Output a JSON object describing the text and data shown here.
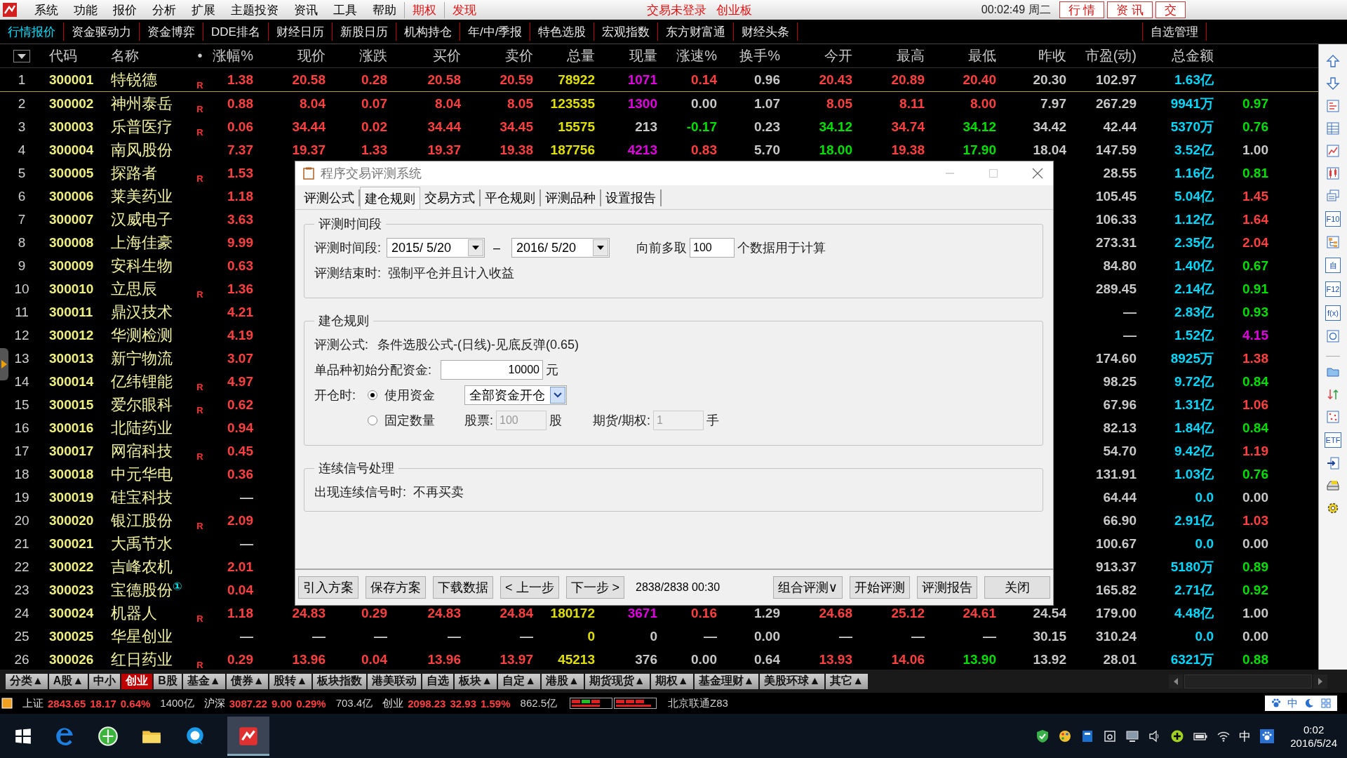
{
  "menu_bar": {
    "items": [
      "系统",
      "功能",
      "报价",
      "分析",
      "扩展",
      "主题投资",
      "资讯",
      "工具",
      "帮助"
    ],
    "highlight_items": [
      "期权",
      "发现"
    ],
    "status": [
      "交易未登录",
      "创业板"
    ],
    "clock": "00:02:49 周二",
    "buttons": [
      "行 情",
      "资 讯",
      "交"
    ]
  },
  "toolbar": {
    "tabs": [
      {
        "label": "行情报价",
        "selected": true
      },
      {
        "label": "资金驱动力",
        "selected": false
      },
      {
        "label": "资金博弈",
        "selected": false
      },
      {
        "label": "DDE排名",
        "selected": false
      },
      {
        "label": "财经日历",
        "selected": false
      },
      {
        "label": "新股日历",
        "selected": false
      },
      {
        "label": "机构持仓",
        "selected": false
      },
      {
        "label": "年/中/季报",
        "selected": false
      },
      {
        "label": "特色选股",
        "selected": false
      },
      {
        "label": "宏观指数",
        "selected": false
      },
      {
        "label": "东方财富通",
        "selected": false
      },
      {
        "label": "财经头条",
        "selected": false
      }
    ],
    "right_tab": "自选管理"
  },
  "table": {
    "key_columns": [
      "代码",
      "名称",
      "•"
    ],
    "columns": [
      "涨幅%",
      "现价",
      "涨跌",
      "买价",
      "卖价",
      "总量",
      "现量",
      "涨速%",
      "换手%",
      "今开",
      "最高",
      "最低",
      "昨收",
      "市盈(动)",
      "总金额"
    ],
    "rows": [
      {
        "no": "1",
        "code": "300001",
        "name": "特锐德",
        "flag": "R",
        "cells": [
          {
            "text": "1.38",
            "color": "#ff4040"
          },
          {
            "text": "20.58",
            "color": "#ff4040"
          },
          {
            "text": "0.28",
            "color": "#ff4040"
          },
          {
            "text": "20.58",
            "color": "#ff4040"
          },
          {
            "text": "20.59",
            "color": "#ff4040"
          },
          {
            "text": "78922",
            "color": "#e0e000"
          },
          {
            "text": "1071",
            "color": "#e000e0"
          },
          {
            "text": "0.14",
            "color": "#ff4040"
          },
          {
            "text": "0.96",
            "color": "#c8c8c8"
          },
          {
            "text": "20.43",
            "color": "#ff4040"
          },
          {
            "text": "20.89",
            "color": "#ff4040"
          },
          {
            "text": "20.40",
            "color": "#ff4040"
          },
          {
            "text": "20.30",
            "color": "#c8c8c8"
          },
          {
            "text": "102.97",
            "color": "#c8c8c8"
          },
          {
            "text": "1.63亿",
            "color": "#00d8ff"
          },
          null
        ]
      },
      {
        "no": "2",
        "code": "300002",
        "name": "神州泰岳",
        "flag": "R",
        "cells": [
          {
            "text": "0.88",
            "color": "#ff4040"
          },
          {
            "text": "8.04",
            "color": "#ff4040"
          },
          {
            "text": "0.07",
            "color": "#ff4040"
          },
          {
            "text": "8.04",
            "color": "#ff4040"
          },
          {
            "text": "8.05",
            "color": "#ff4040"
          },
          {
            "text": "123535",
            "color": "#e0e000"
          },
          {
            "text": "1300",
            "color": "#e000e0"
          },
          {
            "text": "0.00",
            "color": "#c8c8c8"
          },
          {
            "text": "1.07",
            "color": "#c8c8c8"
          },
          {
            "text": "8.05",
            "color": "#ff4040"
          },
          {
            "text": "8.11",
            "color": "#ff4040"
          },
          {
            "text": "8.00",
            "color": "#ff4040"
          },
          {
            "text": "7.97",
            "color": "#c8c8c8"
          },
          {
            "text": "267.29",
            "color": "#c8c8c8"
          },
          {
            "text": "9941万",
            "color": "#00d8ff"
          },
          {
            "text": "0.97",
            "color": "#00e000"
          }
        ]
      },
      {
        "no": "3",
        "code": "300003",
        "name": "乐普医疗",
        "flag": "R",
        "cells": [
          {
            "text": "0.06",
            "color": "#ff4040"
          },
          {
            "text": "34.44",
            "color": "#ff4040"
          },
          {
            "text": "0.02",
            "color": "#ff4040"
          },
          {
            "text": "34.44",
            "color": "#ff4040"
          },
          {
            "text": "34.45",
            "color": "#ff4040"
          },
          {
            "text": "15575",
            "color": "#e0e000"
          },
          {
            "text": "213",
            "color": "#c8c8c8"
          },
          {
            "text": "-0.17",
            "color": "#00e000"
          },
          {
            "text": "0.23",
            "color": "#c8c8c8"
          },
          {
            "text": "34.12",
            "color": "#00e000"
          },
          {
            "text": "34.74",
            "color": "#ff4040"
          },
          {
            "text": "34.12",
            "color": "#00e000"
          },
          {
            "text": "34.42",
            "color": "#c8c8c8"
          },
          {
            "text": "42.44",
            "color": "#c8c8c8"
          },
          {
            "text": "5370万",
            "color": "#00d8ff"
          },
          {
            "text": "0.76",
            "color": "#00e000"
          }
        ]
      },
      {
        "no": "4",
        "code": "300004",
        "name": "南风股份",
        "cells": [
          {
            "text": "7.37",
            "color": "#ff4040"
          },
          {
            "text": "19.37",
            "color": "#ff4040"
          },
          {
            "text": "1.33",
            "color": "#ff4040"
          },
          {
            "text": "19.37",
            "color": "#ff4040"
          },
          {
            "text": "19.38",
            "color": "#ff4040"
          },
          {
            "text": "187756",
            "color": "#e0e000"
          },
          {
            "text": "4213",
            "color": "#e000e0"
          },
          {
            "text": "0.83",
            "color": "#ff4040"
          },
          {
            "text": "5.70",
            "color": "#c8c8c8"
          },
          {
            "text": "18.00",
            "color": "#00e000"
          },
          {
            "text": "19.38",
            "color": "#ff4040"
          },
          {
            "text": "17.90",
            "color": "#00e000"
          },
          {
            "text": "18.04",
            "color": "#c8c8c8"
          },
          {
            "text": "147.59",
            "color": "#c8c8c8"
          },
          {
            "text": "3.52亿",
            "color": "#00d8ff"
          },
          {
            "text": "1.00",
            "color": "#c8c8c8"
          }
        ]
      },
      {
        "no": "5",
        "code": "300005",
        "name": "探路者",
        "flag": "R",
        "cells": [
          {
            "text": "1.53",
            "color": "#ff4040"
          },
          null,
          null,
          null,
          null,
          null,
          null,
          null,
          null,
          null,
          null,
          null,
          null,
          {
            "text": "28.55",
            "color": "#c8c8c8"
          },
          {
            "text": "1.16亿",
            "color": "#00d8ff"
          },
          {
            "text": "0.81",
            "color": "#00e000"
          }
        ]
      },
      {
        "no": "6",
        "code": "300006",
        "name": "莱美药业",
        "cells": [
          {
            "text": "1.18",
            "color": "#ff4040"
          },
          null,
          null,
          null,
          null,
          null,
          null,
          null,
          null,
          null,
          null,
          null,
          null,
          {
            "text": "105.45",
            "color": "#c8c8c8"
          },
          {
            "text": "5.04亿",
            "color": "#00d8ff"
          },
          {
            "text": "1.45",
            "color": "#ff4040"
          }
        ]
      },
      {
        "no": "7",
        "code": "300007",
        "name": "汉威电子",
        "cells": [
          {
            "text": "3.63",
            "color": "#ff4040"
          },
          null,
          null,
          null,
          null,
          null,
          null,
          null,
          null,
          null,
          null,
          null,
          null,
          {
            "text": "106.33",
            "color": "#c8c8c8"
          },
          {
            "text": "1.12亿",
            "color": "#00d8ff"
          },
          {
            "text": "1.64",
            "color": "#ff4040"
          }
        ]
      },
      {
        "no": "8",
        "code": "300008",
        "name": "上海佳豪",
        "cells": [
          {
            "text": "9.99",
            "color": "#ff4040"
          },
          null,
          null,
          null,
          null,
          null,
          null,
          null,
          null,
          null,
          null,
          null,
          null,
          {
            "text": "273.31",
            "color": "#c8c8c8"
          },
          {
            "text": "2.35亿",
            "color": "#00d8ff"
          },
          {
            "text": "2.04",
            "color": "#ff4040"
          }
        ]
      },
      {
        "no": "9",
        "code": "300009",
        "name": "安科生物",
        "cells": [
          {
            "text": "0.63",
            "color": "#ff4040"
          },
          null,
          null,
          null,
          null,
          null,
          null,
          null,
          null,
          null,
          null,
          null,
          null,
          {
            "text": "84.80",
            "color": "#c8c8c8"
          },
          {
            "text": "1.40亿",
            "color": "#00d8ff"
          },
          {
            "text": "0.67",
            "color": "#00e000"
          }
        ]
      },
      {
        "no": "10",
        "code": "300010",
        "name": "立思辰",
        "flag": "R",
        "cells": [
          {
            "text": "1.36",
            "color": "#ff4040"
          },
          null,
          null,
          null,
          null,
          null,
          null,
          null,
          null,
          null,
          null,
          null,
          null,
          {
            "text": "289.45",
            "color": "#c8c8c8"
          },
          {
            "text": "2.14亿",
            "color": "#00d8ff"
          },
          {
            "text": "0.91",
            "color": "#00e000"
          }
        ]
      },
      {
        "no": "11",
        "code": "300011",
        "name": "鼎汉技术",
        "cells": [
          {
            "text": "4.21",
            "color": "#ff4040"
          },
          null,
          null,
          null,
          null,
          null,
          null,
          null,
          null,
          null,
          null,
          null,
          null,
          {
            "text": "—",
            "color": "#c8c8c8"
          },
          {
            "text": "2.83亿",
            "color": "#00d8ff"
          },
          {
            "text": "0.93",
            "color": "#00e000"
          }
        ]
      },
      {
        "no": "12",
        "code": "300012",
        "name": "华测检测",
        "cells": [
          {
            "text": "4.19",
            "color": "#ff4040"
          },
          null,
          null,
          null,
          null,
          null,
          null,
          null,
          null,
          null,
          null,
          null,
          null,
          {
            "text": "—",
            "color": "#c8c8c8"
          },
          {
            "text": "1.52亿",
            "color": "#00d8ff"
          },
          {
            "text": "4.15",
            "color": "#e000e0"
          }
        ]
      },
      {
        "no": "13",
        "code": "300013",
        "name": "新宁物流",
        "cells": [
          {
            "text": "3.07",
            "color": "#ff4040"
          },
          null,
          null,
          null,
          null,
          null,
          null,
          null,
          null,
          null,
          null,
          null,
          null,
          {
            "text": "174.60",
            "color": "#c8c8c8"
          },
          {
            "text": "8925万",
            "color": "#00d8ff"
          },
          {
            "text": "1.38",
            "color": "#ff4040"
          }
        ]
      },
      {
        "no": "14",
        "code": "300014",
        "name": "亿纬锂能",
        "flag": "R",
        "cells": [
          {
            "text": "4.97",
            "color": "#ff4040"
          },
          null,
          null,
          null,
          null,
          null,
          null,
          null,
          null,
          null,
          null,
          null,
          null,
          {
            "text": "98.25",
            "color": "#c8c8c8"
          },
          {
            "text": "9.72亿",
            "color": "#00d8ff"
          },
          {
            "text": "0.84",
            "color": "#00e000"
          }
        ]
      },
      {
        "no": "15",
        "code": "300015",
        "name": "爱尔眼科",
        "flag": "R",
        "cells": [
          {
            "text": "0.62",
            "color": "#ff4040"
          },
          null,
          null,
          null,
          null,
          null,
          null,
          null,
          null,
          null,
          null,
          null,
          null,
          {
            "text": "67.96",
            "color": "#c8c8c8"
          },
          {
            "text": "1.31亿",
            "color": "#00d8ff"
          },
          {
            "text": "1.06",
            "color": "#ff4040"
          }
        ]
      },
      {
        "no": "16",
        "code": "300016",
        "name": "北陆药业",
        "cells": [
          {
            "text": "0.94",
            "color": "#ff4040"
          },
          null,
          null,
          null,
          null,
          null,
          null,
          null,
          null,
          null,
          null,
          null,
          null,
          {
            "text": "82.13",
            "color": "#c8c8c8"
          },
          {
            "text": "1.84亿",
            "color": "#00d8ff"
          },
          {
            "text": "0.84",
            "color": "#00e000"
          }
        ]
      },
      {
        "no": "17",
        "code": "300017",
        "name": "网宿科技",
        "flag": "R",
        "cells": [
          {
            "text": "0.45",
            "color": "#ff4040"
          },
          null,
          null,
          null,
          null,
          null,
          null,
          null,
          null,
          null,
          null,
          null,
          null,
          {
            "text": "54.70",
            "color": "#c8c8c8"
          },
          {
            "text": "9.42亿",
            "color": "#00d8ff"
          },
          {
            "text": "1.19",
            "color": "#ff4040"
          }
        ]
      },
      {
        "no": "18",
        "code": "300018",
        "name": "中元华电",
        "cells": [
          {
            "text": "0.36",
            "color": "#ff4040"
          },
          null,
          null,
          null,
          null,
          null,
          null,
          null,
          null,
          null,
          null,
          null,
          null,
          {
            "text": "131.91",
            "color": "#c8c8c8"
          },
          {
            "text": "1.03亿",
            "color": "#00d8ff"
          },
          {
            "text": "0.76",
            "color": "#00e000"
          }
        ]
      },
      {
        "no": "19",
        "code": "300019",
        "name": "硅宝科技",
        "cells": [
          {
            "text": "—",
            "color": "#c8c8c8"
          },
          null,
          null,
          null,
          null,
          null,
          null,
          null,
          null,
          null,
          null,
          null,
          null,
          {
            "text": "64.44",
            "color": "#c8c8c8"
          },
          {
            "text": "0.0",
            "color": "#00d8ff"
          },
          {
            "text": "0.00",
            "color": "#c8c8c8"
          }
        ]
      },
      {
        "no": "20",
        "code": "300020",
        "name": "银江股份",
        "flag": "R",
        "cells": [
          {
            "text": "2.09",
            "color": "#ff4040"
          },
          null,
          null,
          null,
          null,
          null,
          null,
          null,
          null,
          null,
          null,
          null,
          null,
          {
            "text": "66.90",
            "color": "#c8c8c8"
          },
          {
            "text": "2.91亿",
            "color": "#00d8ff"
          },
          {
            "text": "1.03",
            "color": "#ff4040"
          }
        ]
      },
      {
        "no": "21",
        "code": "300021",
        "name": "大禹节水",
        "cells": [
          {
            "text": "—",
            "color": "#c8c8c8"
          },
          null,
          null,
          null,
          null,
          null,
          null,
          null,
          null,
          null,
          null,
          null,
          null,
          {
            "text": "100.67",
            "color": "#c8c8c8"
          },
          {
            "text": "0.0",
            "color": "#00d8ff"
          },
          {
            "text": "0.00",
            "color": "#c8c8c8"
          }
        ]
      },
      {
        "no": "22",
        "code": "300022",
        "name": "吉峰农机",
        "cells": [
          {
            "text": "2.01",
            "color": "#ff4040"
          },
          null,
          null,
          null,
          null,
          null,
          null,
          null,
          null,
          null,
          null,
          null,
          null,
          {
            "text": "913.37",
            "color": "#c8c8c8"
          },
          {
            "text": "5180万",
            "color": "#00d8ff"
          },
          {
            "text": "0.89",
            "color": "#00e000"
          }
        ]
      },
      {
        "no": "23",
        "code": "300023",
        "name": "宝德股份",
        "badge": "①",
        "cells": [
          {
            "text": "0.04",
            "color": "#ff4040"
          },
          null,
          null,
          null,
          null,
          null,
          null,
          null,
          null,
          null,
          null,
          null,
          null,
          {
            "text": "165.82",
            "color": "#c8c8c8"
          },
          {
            "text": "2.71亿",
            "color": "#00d8ff"
          },
          {
            "text": "0.92",
            "color": "#00e000"
          }
        ]
      },
      {
        "no": "24",
        "code": "300024",
        "name": "机器人",
        "flag": "R",
        "cells": [
          {
            "text": "1.18",
            "color": "#ff4040"
          },
          {
            "text": "24.83",
            "color": "#ff4040"
          },
          {
            "text": "0.29",
            "color": "#ff4040"
          },
          {
            "text": "24.83",
            "color": "#ff4040"
          },
          {
            "text": "24.84",
            "color": "#ff4040"
          },
          {
            "text": "180172",
            "color": "#e0e000"
          },
          {
            "text": "3671",
            "color": "#e000e0"
          },
          {
            "text": "0.16",
            "color": "#ff4040"
          },
          {
            "text": "1.29",
            "color": "#c8c8c8"
          },
          {
            "text": "24.68",
            "color": "#ff4040"
          },
          {
            "text": "25.12",
            "color": "#ff4040"
          },
          {
            "text": "24.61",
            "color": "#ff4040"
          },
          {
            "text": "24.54",
            "color": "#c8c8c8"
          },
          {
            "text": "179.00",
            "color": "#c8c8c8"
          },
          {
            "text": "4.48亿",
            "color": "#00d8ff"
          },
          {
            "text": "1.00",
            "color": "#c8c8c8"
          }
        ]
      },
      {
        "no": "25",
        "code": "300025",
        "name": "华星创业",
        "cells": [
          {
            "text": "—",
            "color": "#c8c8c8"
          },
          {
            "text": "—",
            "color": "#c8c8c8"
          },
          {
            "text": "—",
            "color": "#c8c8c8"
          },
          {
            "text": "—",
            "color": "#c8c8c8"
          },
          {
            "text": "—",
            "color": "#c8c8c8"
          },
          {
            "text": "0",
            "color": "#e0e000"
          },
          {
            "text": "0",
            "color": "#c8c8c8"
          },
          {
            "text": "—",
            "color": "#c8c8c8"
          },
          {
            "text": "0.00",
            "color": "#c8c8c8"
          },
          {
            "text": "—",
            "color": "#c8c8c8"
          },
          {
            "text": "—",
            "color": "#c8c8c8"
          },
          {
            "text": "—",
            "color": "#c8c8c8"
          },
          {
            "text": "30.15",
            "color": "#c8c8c8"
          },
          {
            "text": "310.24",
            "color": "#c8c8c8"
          },
          {
            "text": "0.0",
            "color": "#00d8ff"
          },
          {
            "text": "0.00",
            "color": "#c8c8c8"
          }
        ]
      },
      {
        "no": "26",
        "code": "300026",
        "name": "红日药业",
        "flag": "R",
        "cells": [
          {
            "text": "0.29",
            "color": "#ff4040"
          },
          {
            "text": "13.96",
            "color": "#ff4040"
          },
          {
            "text": "0.04",
            "color": "#ff4040"
          },
          {
            "text": "13.96",
            "color": "#ff4040"
          },
          {
            "text": "13.97",
            "color": "#ff4040"
          },
          {
            "text": "45213",
            "color": "#e0e000"
          },
          {
            "text": "376",
            "color": "#c8c8c8"
          },
          {
            "text": "0.00",
            "color": "#c8c8c8"
          },
          {
            "text": "0.64",
            "color": "#c8c8c8"
          },
          {
            "text": "13.93",
            "color": "#ff4040"
          },
          {
            "text": "14.06",
            "color": "#ff4040"
          },
          {
            "text": "13.90",
            "color": "#00e000"
          },
          {
            "text": "13.92",
            "color": "#c8c8c8"
          },
          {
            "text": "28.01",
            "color": "#c8c8c8"
          },
          {
            "text": "6321万",
            "color": "#00d8ff"
          },
          {
            "text": "0.88",
            "color": "#00e000"
          }
        ]
      }
    ]
  },
  "dialog": {
    "title": "程序交易评测系统",
    "tabs": [
      {
        "label": "评测公式",
        "selected": false
      },
      {
        "label": "建仓规则",
        "selected": true
      },
      {
        "label": "交易方式",
        "selected": false
      },
      {
        "label": "平仓规则",
        "selected": false
      },
      {
        "label": "评测品种",
        "selected": false
      },
      {
        "label": "设置报告",
        "selected": false
      }
    ],
    "period": {
      "title": "评测时间段",
      "label": "评测时间段:",
      "start": "2015/ 5/20",
      "separator": "–",
      "end": "2016/ 5/20",
      "lookback_label": "向前多取",
      "lookback": "100",
      "lookback_suffix": "个数据用于计算",
      "end_label": "评测结束时:",
      "end_value": "强制平仓并且计入收益"
    },
    "entry": {
      "title": "建仓规则",
      "formula_label": "评测公式:",
      "formula": "条件选股公式-(日线)-见底反弹(0.65)",
      "capital_label": "单品种初始分配资金:",
      "capital": "10000",
      "capital_unit": "元",
      "open_label": "开仓时:",
      "options": [
        {
          "label": "使用资金",
          "selected": true
        },
        {
          "label": "固定数量",
          "selected": false
        }
      ],
      "fund_mode": "全部资金开仓",
      "stock_label": "股票:",
      "stock_qty": "100",
      "stock_unit": "股",
      "futures_label": "期货/期权:",
      "futures_qty": "1",
      "futures_unit": "手"
    },
    "signals": {
      "title": "连续信号处理",
      "label": "出现连续信号时:",
      "value": "不再买卖"
    },
    "buttons_left": [
      "引入方案",
      "保存方案",
      "下载数据",
      "< 上一步",
      "下一步 >"
    ],
    "progress": "2838/2838  00:30",
    "buttons_right": [
      "组合评测∨",
      "开始评测",
      "评测报告",
      "关闭"
    ]
  },
  "side_toolbar": [
    {
      "kind": "icon"
    },
    {
      "kind": "icon"
    },
    {
      "kind": "icon"
    },
    {
      "kind": "icon"
    },
    {
      "kind": "icon"
    },
    {
      "kind": "icon"
    },
    {
      "kind": "icon"
    },
    {
      "kind": "text",
      "label": "F10"
    },
    {
      "kind": "icon"
    },
    {
      "kind": "text",
      "label": "自"
    },
    {
      "kind": "text",
      "label": "F12"
    },
    {
      "kind": "text",
      "label": "f(x)"
    },
    {
      "kind": "icon"
    },
    {
      "kind": "icon"
    },
    {
      "kind": "icon"
    },
    {
      "kind": "icon"
    },
    {
      "kind": "text",
      "label": "ETF"
    },
    {
      "kind": "icon"
    },
    {
      "kind": "icon"
    },
    {
      "kind": "icon"
    }
  ],
  "bottom_tabs": [
    {
      "label": "分类▲",
      "selected": false
    },
    {
      "label": "A股▲",
      "selected": false
    },
    {
      "label": "中小",
      "selected": false
    },
    {
      "label": "创业",
      "selected": true
    },
    {
      "label": "B股",
      "selected": false
    },
    {
      "label": "基金▲",
      "selected": false
    },
    {
      "label": "债券▲",
      "selected": false
    },
    {
      "label": "股转▲",
      "selected": false
    },
    {
      "label": "板块指数",
      "selected": false
    },
    {
      "label": "港美联动",
      "selected": false
    },
    {
      "label": "自选",
      "selected": false
    },
    {
      "label": "板块▲",
      "selected": false
    },
    {
      "label": "自定▲",
      "selected": false
    },
    {
      "label": "港股▲",
      "selected": false
    },
    {
      "label": "期货现货▲",
      "selected": false
    },
    {
      "label": "期权▲",
      "selected": false
    },
    {
      "label": "基金理财▲",
      "selected": false
    },
    {
      "label": "美股环球▲",
      "selected": false
    },
    {
      "label": "其它▲",
      "selected": false
    }
  ],
  "status_bar": {
    "indices": [
      {
        "name": "上证",
        "value": "2843.65",
        "change": "18.17",
        "percent": "0.64%",
        "amount": "1400亿"
      },
      {
        "name": "沪深",
        "value": "3087.22",
        "change": "9.00",
        "percent": "0.29%",
        "amount": "703.4亿"
      },
      {
        "name": "创业",
        "value": "2098.23",
        "change": "32.93",
        "percent": "1.59%",
        "amount": "862.5亿"
      }
    ],
    "network": "北京联通Z83"
  },
  "ime_bar": {
    "label": "中"
  },
  "taskbar": {
    "ime": "中",
    "time": "0:02",
    "date": "2016/5/24"
  }
}
